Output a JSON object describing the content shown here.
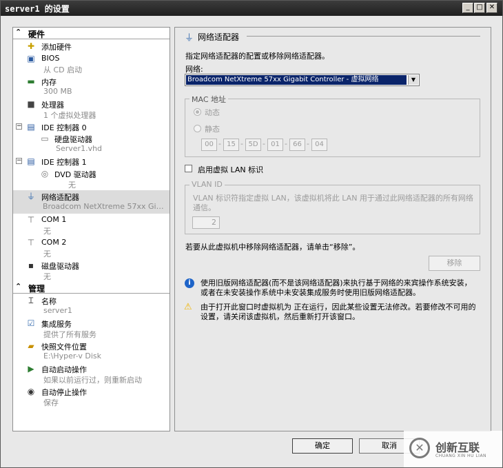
{
  "window": {
    "title": "server1 的设置"
  },
  "titlebar_buttons": {
    "minimize": "_",
    "maximize": "□",
    "close": "✕"
  },
  "hardware": {
    "header": "硬件",
    "items": [
      {
        "name": "添加硬件",
        "sub": "",
        "icon": "add-hardware-icon"
      },
      {
        "name": "BIOS",
        "sub": "从 CD 启动",
        "icon": "bios-icon"
      },
      {
        "name": "内存",
        "sub": "300 MB",
        "icon": "memory-icon"
      },
      {
        "name": "处理器",
        "sub": "1 个虚拟处理器",
        "icon": "processor-icon"
      },
      {
        "name": "IDE 控制器 0",
        "sub": "",
        "icon": "ide-controller-icon",
        "expander": "−"
      },
      {
        "name": "硬盘驱动器",
        "sub": "Server1.vhd",
        "icon": "hard-drive-icon"
      },
      {
        "name": "IDE 控制器 1",
        "sub": "",
        "icon": "ide-controller-icon",
        "expander": "−"
      },
      {
        "name": "DVD 驱动器",
        "sub": "无",
        "icon": "dvd-drive-icon"
      },
      {
        "name": "网络适配器",
        "sub": "Broadcom NetXtreme 57xx Gigabit ...",
        "icon": "network-adapter-icon"
      },
      {
        "name": "COM 1",
        "sub": "无",
        "icon": "com-port-icon"
      },
      {
        "name": "COM 2",
        "sub": "无",
        "icon": "com-port-icon"
      },
      {
        "name": "磁盘驱动器",
        "sub": "无",
        "icon": "floppy-drive-icon"
      }
    ]
  },
  "management": {
    "header": "管理",
    "items": [
      {
        "name": "名称",
        "sub": "server1",
        "icon": "name-icon"
      },
      {
        "name": "集成服务",
        "sub": "提供了所有服务",
        "icon": "integration-services-icon"
      },
      {
        "name": "快照文件位置",
        "sub": "E:\\Hyper-v Disk",
        "icon": "snapshot-folder-icon"
      },
      {
        "name": "自动启动操作",
        "sub": "如果以前运行过，则重新启动",
        "icon": "auto-start-icon"
      },
      {
        "name": "自动停止操作",
        "sub": "保存",
        "icon": "auto-stop-icon"
      }
    ]
  },
  "detail": {
    "heading": "网络适配器",
    "description": "指定网络适配器的配置或移除网络适配器。",
    "network_label": "网络:",
    "network_value": "Broadcom NetXtreme 57xx Gigabit Controller - 虚拟网络",
    "mac_group": "MAC 地址",
    "mac_dynamic": "动态",
    "mac_static": "静态",
    "mac_octets": [
      "00",
      "15",
      "5D",
      "01",
      "66",
      "04"
    ],
    "vlan_checkbox": "启用虚拟 LAN 标识",
    "vlan_group": "VLAN ID",
    "vlan_desc": "VLAN 标识符指定虚拟 LAN，该虚拟机将此 LAN 用于通过此网络适配器的所有网络通信。",
    "vlan_value": "2",
    "remove_hint": "若要从此虚拟机中移除网络适配器，请单击“移除”。",
    "remove_button": "移除",
    "info_text": "使用旧版网络适配器(而不是该网络适配器)来执行基于网络的来宾操作系统安装，或者在未安装操作系统中未安装集成服务时使用旧版网络适配器。",
    "warning_text": "由于打开此窗口时虚拟机为 正在运行，因此某些设置无法修改。若要修改不可用的设置，请关闭该虚拟机，然后重新打开该窗口。"
  },
  "footer": {
    "ok": "确定",
    "cancel": "取消"
  },
  "watermark": {
    "cn": "创新互联",
    "en": "CHUANG XIN HU LIAN"
  },
  "colors": {
    "titlebar": "#1f1f1f",
    "selection": "#dcdcdc",
    "combo_selected": "#0a246a",
    "info": "#1e64c8",
    "warning": "#f0b400"
  }
}
